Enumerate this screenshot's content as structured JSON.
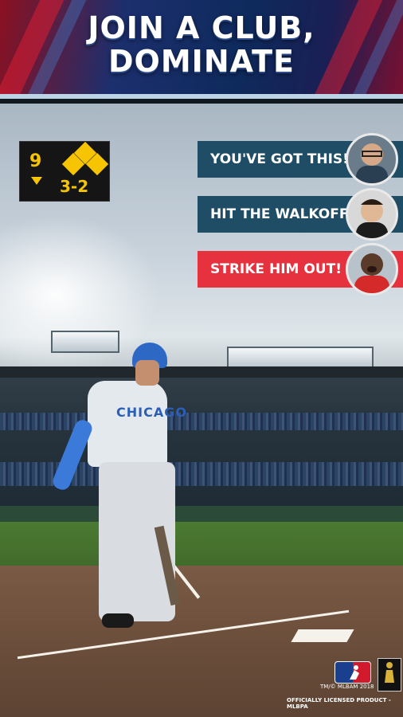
{
  "banner": {
    "headline_line1": "JOIN A CLUB,",
    "headline_line2": "DOMINATE"
  },
  "scoreboard": {
    "inning": "9",
    "count": "3-2",
    "inning_half": "bottom",
    "bases_occupied": [
      "first",
      "second",
      "third"
    ],
    "accent_color": "#f6c400"
  },
  "chats": [
    {
      "message": "YOU'VE GOT THIS!",
      "bg_color": "#1f4d66"
    },
    {
      "message": "HIT THE WALKOFF!",
      "bg_color": "#1f4d66"
    },
    {
      "message": "STRIKE HIM OUT!",
      "bg_color": "#e5323e"
    }
  ],
  "jersey": {
    "team": "CHICAGO"
  },
  "footer": {
    "copyright": "TM/© MLBAM 2018",
    "license": "OFFICIALLY LICENSED PRODUCT - MLBPA"
  }
}
